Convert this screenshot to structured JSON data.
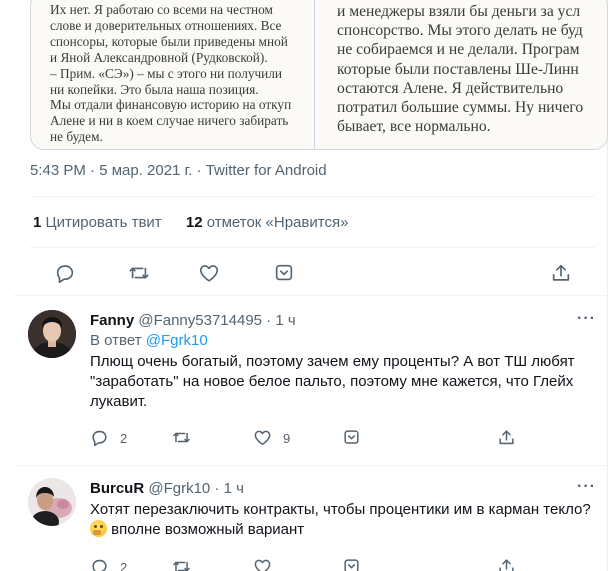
{
  "image_text": {
    "left_lines": [
      "Их нет. Я работаю со всеми на честном",
      "слове и доверительных отношениях. Все",
      "спонсоры, которые были приведены мной",
      "и Яной Александровной (Рудковской).",
      "– Прим. «СЭ») – мы с этого ни получили",
      "ни копейки. Это была наша позиция.",
      "Мы отдали финансовую историю на откуп",
      "Алене и ни в коем случае ничего забирать",
      "не будем."
    ],
    "right_lines": [
      "и менеджеры взяли бы деньги за усл",
      "спонсорство. Мы этого делать не буд",
      "не собираемся и не делали. Програм",
      "которые были поставлены Ше-Линн",
      "остаются Алене. Я действительно",
      "потратил большие суммы. Ну ничего",
      "бывает, все нормально."
    ]
  },
  "tweet": {
    "meta": "5:43 PM · 5 мар. 2021 г. · Twitter for Android",
    "quotes_count": "1",
    "quotes_label": "Цитировать твит",
    "likes_count": "12",
    "likes_label": "отметок «Нравится»"
  },
  "replies": [
    {
      "name": "Fanny",
      "handle": "@Fanny53714495 · 1 ч",
      "reply_prefix": "В ответ",
      "reply_to": "@Fgrk10",
      "text": "Плющ очень богатый, поэтому зачем ему проценты? А вот ТШ любят \"заработать\" на новое белое пальто, поэтому мне кажется, что Глейх лукавит.",
      "reply_count": "2",
      "retweet_count": "",
      "like_count": "9"
    },
    {
      "name": "BurcuR",
      "handle": "@Fgrk10 · 1 ч",
      "text_line1": "Хотят перезаключить контракты, чтобы процентики им в карман текло?",
      "text_line2": "вполне возможный вариант",
      "emoji": "thinking-face",
      "reply_count": "2"
    }
  ],
  "more_label": "···",
  "colors": {
    "secondary": "#536471",
    "link": "#1d9bf0",
    "divider": "#eff3f4"
  }
}
